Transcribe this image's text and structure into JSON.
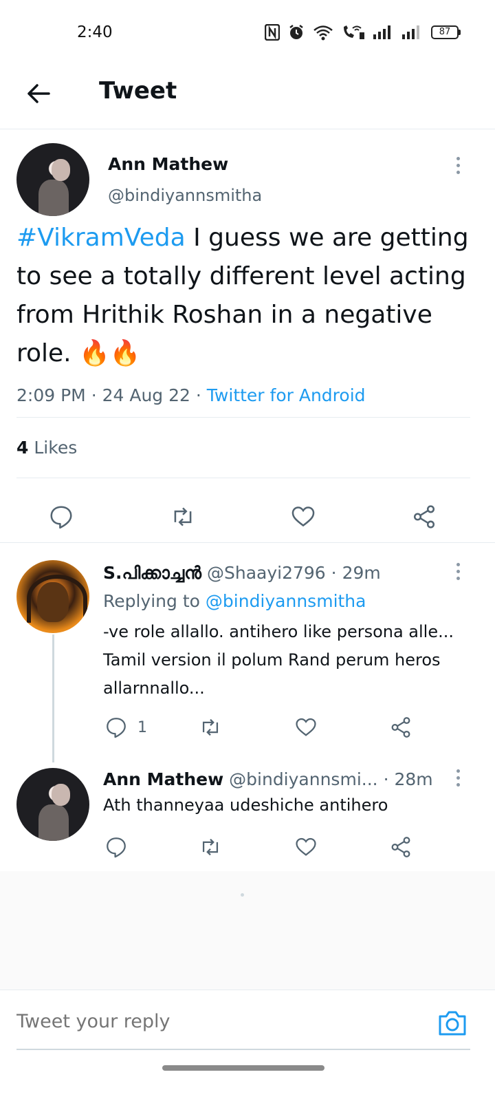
{
  "status_bar": {
    "time": "2:40",
    "battery": "87",
    "icons": [
      "nfc-icon",
      "alarm-icon",
      "wifi-icon",
      "wifi-call-icon",
      "signal-icon",
      "signal-icon",
      "battery-icon"
    ]
  },
  "header": {
    "title": "Tweet",
    "back_icon": "arrow-left-icon"
  },
  "main_tweet": {
    "author_name": "Ann Mathew",
    "author_handle": "@bindiyannsmitha",
    "hashtag": "#VikramVeda",
    "text": " I guess we are getting to see a totally different level acting from Hrithik Roshan in a negative role. ",
    "emoji": "🔥🔥",
    "time": "2:09 PM",
    "date": "24 Aug 22",
    "source": "Twitter for Android",
    "likes_count": "4",
    "likes_label": "Likes",
    "actions": [
      "reply-icon",
      "retweet-icon",
      "like-icon",
      "share-icon"
    ]
  },
  "replies": [
    {
      "author_name": "S.പിക്കാച്ചൻ",
      "author_handle": "@Shaayi2796",
      "age": "29m",
      "replying_label": "Replying to",
      "replying_to": "@bindiyannsmitha",
      "text": "-ve role allallo. antihero like persona alle... Tamil version il polum Rand perum heros allarnnallo...",
      "reply_count": "1"
    },
    {
      "author_name": "Ann Mathew",
      "author_handle": "@bindiyannsmi...",
      "age": "28m",
      "text": "Ath thanneyaa udeshiche antihero"
    }
  ],
  "composer": {
    "placeholder": "Tweet your reply",
    "camera_icon": "camera-icon"
  },
  "colors": {
    "accent": "#1d9bf0",
    "text_primary": "#0f1419",
    "text_secondary": "#536471",
    "divider": "#e6ecf0"
  }
}
